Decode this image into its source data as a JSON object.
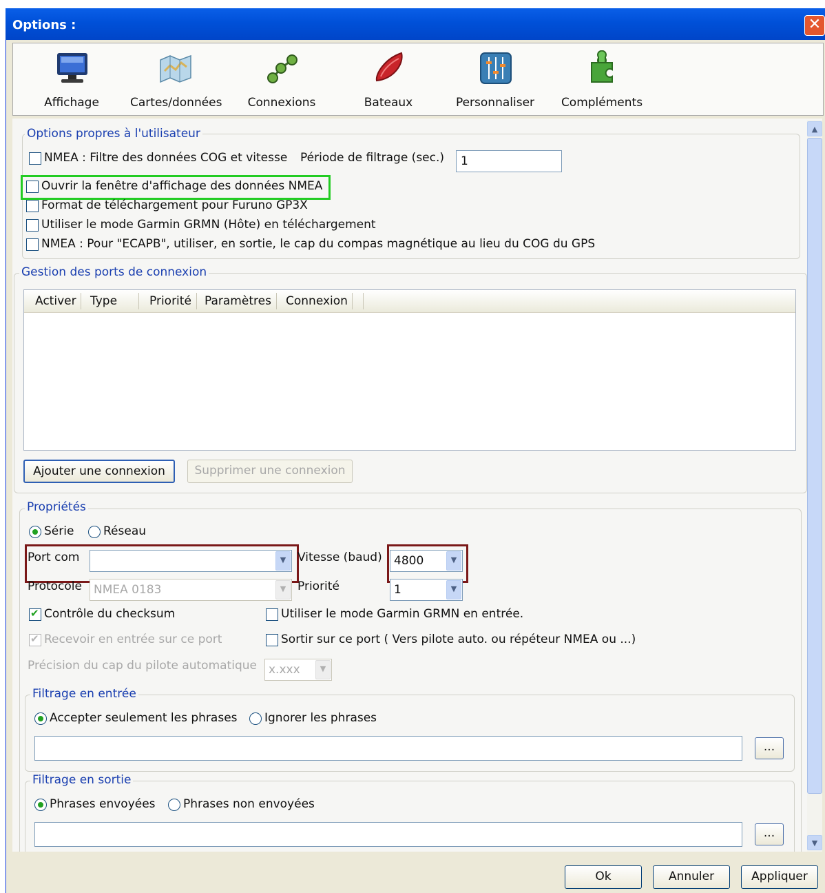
{
  "window": {
    "title": "Options :",
    "close_glyph": "✕"
  },
  "toolbar": [
    {
      "label": "Affichage",
      "icon": "monitor-icon"
    },
    {
      "label": "Cartes/données",
      "icon": "map-icon"
    },
    {
      "label": "Connexions",
      "icon": "connections-icon"
    },
    {
      "label": "Bateaux",
      "icon": "boat-icon"
    },
    {
      "label": "Personnaliser",
      "icon": "sliders-icon"
    },
    {
      "label": "Compléments",
      "icon": "puzzle-icon"
    }
  ],
  "user_options": {
    "legend": "Options propres à l'utilisateur",
    "nmea_filter": {
      "label": "NMEA : Filtre des données COG et vitesse",
      "checked": false
    },
    "filter_period": {
      "label": "Période de filtrage (sec.)",
      "value": "1"
    },
    "open_nmea_window": {
      "label": "Ouvrir la fenêtre d'affichage des données NMEA",
      "checked": false
    },
    "furuno_format": {
      "label": "Format de téléchargement pour Furuno GP3X",
      "checked": false
    },
    "garmin_host": {
      "label": "Utiliser le mode Garmin GRMN (Hôte) en téléchargement",
      "checked": false
    },
    "ecapb": {
      "label": "NMEA : Pour \"ECAPB\", utiliser, en sortie, le cap du compas magnétique  au lieu du COG du GPS",
      "checked": false
    }
  },
  "ports": {
    "legend": "Gestion des ports de connexion",
    "columns": [
      "Activer",
      "Type",
      "Priorité",
      "Paramètres",
      "Connexion"
    ],
    "rows": [],
    "add_button": "Ajouter une connexion",
    "remove_button": "Supprimer une connexion"
  },
  "properties": {
    "legend": "Propriétés",
    "serie": "Série",
    "reseau": "Réseau",
    "port_com_label": "Port com",
    "port_com_value": "",
    "speed_label": "Vitesse (baud)",
    "speed_value": "4800",
    "protocol_label": "Protocole",
    "protocol_value": "NMEA 0183",
    "priority_label": "Priorité",
    "priority_value": "1",
    "checksum": "Contrôle du checksum",
    "garmin_input": "Utiliser le mode Garmin GRMN en entrée.",
    "receive_input": "Recevoir en entrée sur ce port",
    "output_port": "Sortir sur ce port ( Vers pilote auto. ou répéteur NMEA ou ...)",
    "autopilot_precision_label": "Précision du cap du pilote automatique",
    "autopilot_precision_value": "x.xxx"
  },
  "input_filter": {
    "legend": "Filtrage en entrée",
    "accept": "Accepter seulement les phrases",
    "ignore": "Ignorer les phrases",
    "value": "",
    "browse": "..."
  },
  "output_filter": {
    "legend": "Filtrage en sortie",
    "sent": "Phrases envoyées",
    "not_sent": "Phrases non envoyées",
    "value": "",
    "browse": "..."
  },
  "footer": {
    "ok": "Ok",
    "cancel": "Annuler",
    "apply": "Appliquer"
  },
  "colors": {
    "titlebar": "#0050d8",
    "legend": "#1a3fb0",
    "highlight_green": "#22cc22",
    "highlight_red": "#7a1818"
  }
}
